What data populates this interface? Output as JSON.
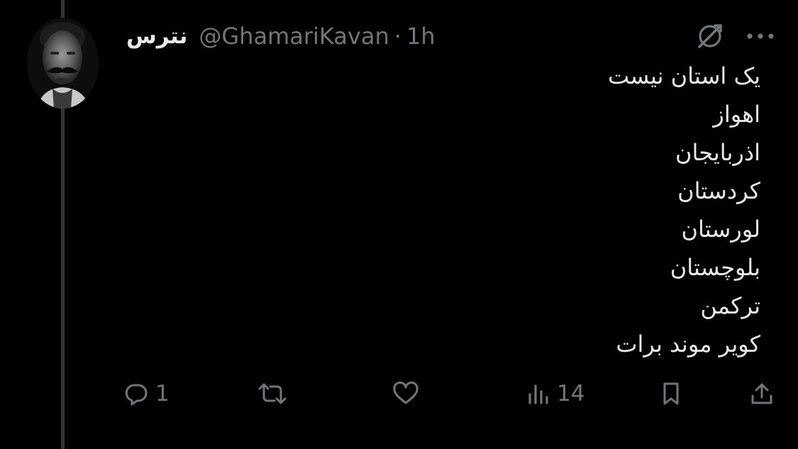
{
  "tweet": {
    "display_name": "نترس",
    "handle": "@GhamariKavan",
    "separator": "·",
    "time": "1h",
    "lines": [
      "یک استان نیست",
      "اهواز",
      "اذربایجان",
      "کردستان",
      "لورستان",
      "بلوچستان",
      "ترکمن",
      "کویر موند برات"
    ]
  },
  "actions": {
    "replies": "1",
    "views": "14"
  },
  "icons": {
    "grok": "grok-icon",
    "more": "more-icon",
    "reply": "reply-icon",
    "retweet": "retweet-icon",
    "like": "heart-icon",
    "views": "views-icon",
    "bookmark": "bookmark-icon",
    "share": "share-icon"
  },
  "colors": {
    "background": "#000000",
    "text": "#e7e9ea",
    "muted": "#71767b",
    "thread_line": "#333639"
  }
}
